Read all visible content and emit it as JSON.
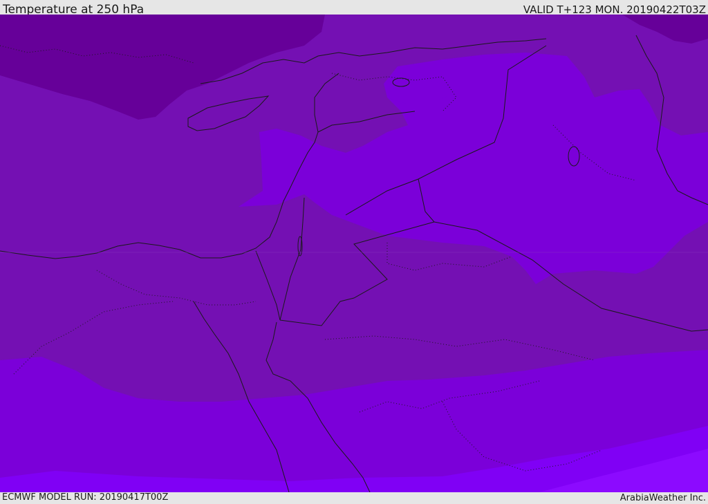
{
  "header": {
    "title": "Temperature at 250 hPa",
    "valid_time": "VALID T+123 MON. 20190422T03Z"
  },
  "footer": {
    "model_run": "ECMWF MODEL RUN: 20190417T00Z",
    "provider": "ArabiaWeather Inc."
  },
  "colors": {
    "coldest_band": "#660099",
    "cold_band": "#7410b3",
    "mid_band": "#7b00d9",
    "warm_band": "#8000f5",
    "warmest_band": "#8c0aff",
    "border_line": "#1a1a1a",
    "page_background": "#e6e6e6"
  }
}
